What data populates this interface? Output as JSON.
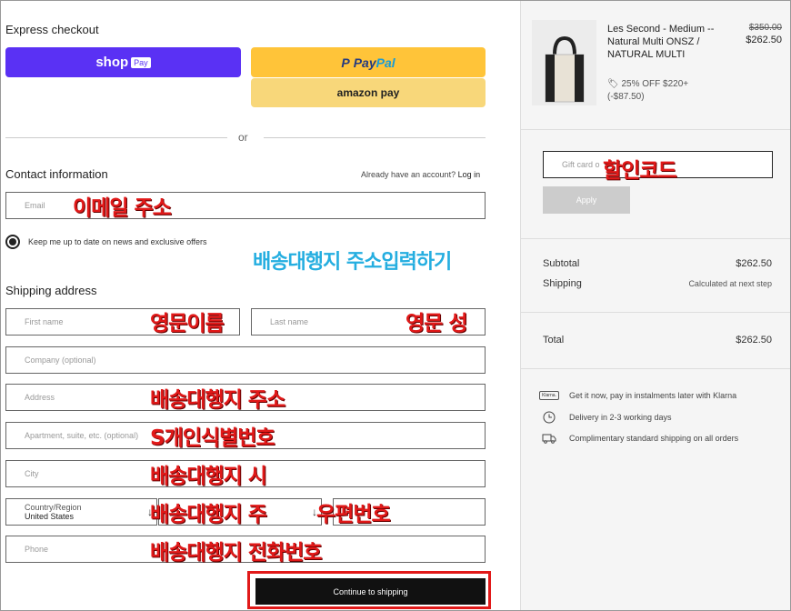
{
  "express": {
    "title": "Express checkout",
    "shop_label": "shop",
    "shop_badge": "Pay",
    "paypal_p": "P",
    "paypal_pay": "Pay",
    "paypal_pal": "Pal",
    "amazon_label": "amazon pay"
  },
  "divider_or": "or",
  "contact": {
    "title": "Contact information",
    "account_prompt": "Already have an account?",
    "login_link": "Log in",
    "email_placeholder": "Email",
    "newsletter_label": "Keep me up to date on news and exclusive offers",
    "newsletter_checked": true
  },
  "shipping": {
    "title": "Shipping address",
    "first_name_placeholder": "First name",
    "last_name_placeholder": "Last name",
    "company_placeholder": "Company (optional)",
    "address_placeholder": "Address",
    "apartment_placeholder": "Apartment, suite, etc. (optional)",
    "city_placeholder": "City",
    "country_label": "Country/Region",
    "country_value": "United States",
    "phone_placeholder": "Phone",
    "continue_label": "Continue to shipping"
  },
  "annotations": {
    "email": "이메일 주소",
    "shipping_header": "배송대행지 주소입력하기",
    "first_name": "영문이름",
    "last_name": "영문 성",
    "address": "배송대행지 주소",
    "apartment": "S개인식별번호",
    "city": "배송대행지 시",
    "state": "배송대행지 주",
    "zip": "우편번호",
    "phone": "배송대행지 전화번호",
    "gift": "할인코드"
  },
  "cart": {
    "product_name": "Les Second - Medium -- Natural Multi ONSZ / NATURAL MULTI",
    "price_original": "$350.00",
    "price_current": "$262.50",
    "discount_text": "25% OFF $220+",
    "discount_amount": "(-$87.50)",
    "gift_placeholder": "Gift card o",
    "apply_label": "Apply",
    "subtotal_label": "Subtotal",
    "subtotal_value": "$262.50",
    "shipping_label": "Shipping",
    "shipping_value": "Calculated at next step",
    "total_label": "Total",
    "total_value": "$262.50"
  },
  "perks": [
    {
      "icon": "klarna-icon",
      "badge": "Klarna.",
      "text": "Get it now, pay in instalments later with Klarna"
    },
    {
      "icon": "clock-icon",
      "text": "Delivery in 2-3 working days"
    },
    {
      "icon": "truck-icon",
      "text": "Complimentary standard shipping on all orders"
    }
  ],
  "colors": {
    "shop_purple": "#5a31f4",
    "paypal_yellow": "#ffc439",
    "amazon_yellow": "#f8d77a",
    "annotation_red": "#e11919",
    "annotation_blue": "#25aee0"
  }
}
